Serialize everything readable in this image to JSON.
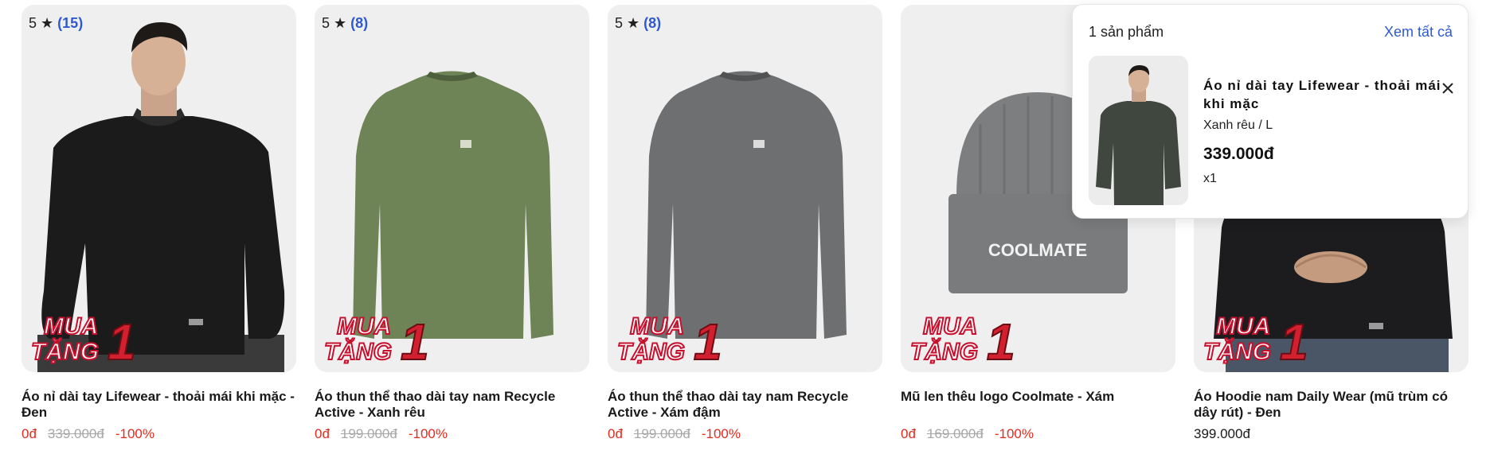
{
  "products": [
    {
      "rating": "5 ★",
      "reviews": "(15)",
      "title": "Áo nỉ dài tay Lifewear - thoải mái khi mặc - Đen",
      "price": "0đ",
      "old_price": "339.000đ",
      "discount": "-100%",
      "promo": "MUA TẶNG 1",
      "image_icon": "black-sweater-model"
    },
    {
      "rating": "5 ★",
      "reviews": "(8)",
      "title": "Áo thun thể thao dài tay nam Recycle Active - Xanh rêu",
      "price": "0đ",
      "old_price": "199.000đ",
      "discount": "-100%",
      "promo": "MUA TẶNG 1",
      "image_icon": "green-longsleeve-tee"
    },
    {
      "rating": "5 ★",
      "reviews": "(8)",
      "title": "Áo thun thể thao dài tay nam Recycle Active - Xám đậm",
      "price": "0đ",
      "old_price": "199.000đ",
      "discount": "-100%",
      "promo": "MUA TẶNG 1",
      "image_icon": "grey-longsleeve-tee"
    },
    {
      "rating": "",
      "reviews": "",
      "title": "Mũ len thêu logo Coolmate - Xám",
      "price": "0đ",
      "old_price": "169.000đ",
      "discount": "-100%",
      "promo": "MUA TẶNG 1",
      "beanie_text": "COOLMATE",
      "image_icon": "grey-beanie"
    },
    {
      "rating": "",
      "reviews": "",
      "title": "Áo Hoodie nam Daily Wear (mũ trùm có dây rút) - Đen",
      "price": "399.000đ",
      "old_price": "",
      "discount": "",
      "promo": "MUA TẶNG 1",
      "image_icon": "black-hoodie-model"
    }
  ],
  "cart_popup": {
    "count_label": "1 sản phẩm",
    "view_all": "Xem tất cả",
    "item": {
      "name": "Áo nỉ dài tay Lifewear - thoải mái khi mặc",
      "variant": "Xanh rêu / L",
      "price": "339.000đ",
      "qty": "x1"
    }
  },
  "colors": {
    "accent": "#2f5acf",
    "sale": "#e22b1e",
    "strike": "#a7a7a7",
    "card_bg": "#efefef"
  }
}
